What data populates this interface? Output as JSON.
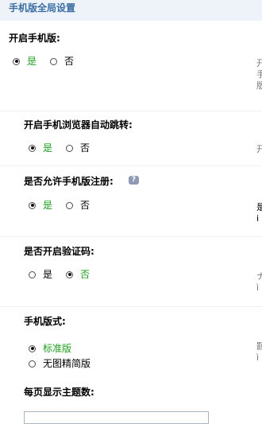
{
  "header": {
    "title": "手机版全局设置"
  },
  "settings": [
    {
      "label": "开启手机版:",
      "options": [
        {
          "label": "是",
          "checked": true
        },
        {
          "label": "否",
          "checked": false
        }
      ],
      "side": [
        "开",
        "手",
        "版"
      ]
    },
    {
      "label": "开启手机浏览器自动跳转:",
      "options": [
        {
          "label": "是",
          "checked": true
        },
        {
          "label": "否",
          "checked": false
        }
      ],
      "side": [
        "开"
      ]
    },
    {
      "label": "是否允许手机版注册:",
      "options": [
        {
          "label": "是",
          "checked": true
        },
        {
          "label": "否",
          "checked": false
        }
      ],
      "side": [
        "是",
        "i"
      ]
    },
    {
      "label": "是否开启验证码:",
      "options": [
        {
          "label": "是",
          "checked": false
        },
        {
          "label": "否",
          "checked": true
        }
      ],
      "side": [
        "ナ",
        "ì"
      ]
    },
    {
      "label": "手机版式:",
      "options": [
        {
          "label": "标准版",
          "checked": true
        },
        {
          "label": "无图精简版",
          "checked": false
        }
      ],
      "side": [
        "颢",
        "ì"
      ]
    },
    {
      "label": "每页显示主题数:"
    }
  ],
  "help_icon": "question-bubble-icon"
}
